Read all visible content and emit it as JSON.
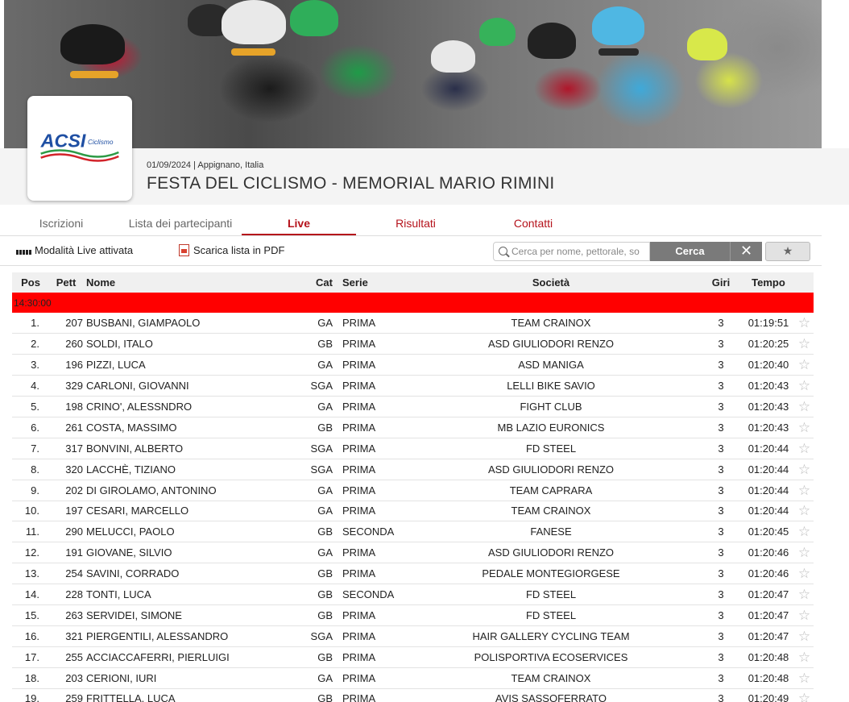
{
  "event": {
    "date_location": "01/09/2024 | Appignano, Italia",
    "title": "FESTA DEL CICLISMO - MEMORIAL MARIO RIMINI",
    "logo_text": "ACSI",
    "logo_subtext": "Ciclismo"
  },
  "tabs": [
    {
      "label": "Iscrizioni"
    },
    {
      "label": "Lista dei partecipanti"
    },
    {
      "label": "Live",
      "active": true
    },
    {
      "label": "Risultati"
    },
    {
      "label": "Contatti"
    }
  ],
  "toolbar": {
    "live_mode": "Modalità Live attivata",
    "pdf_link": "Scarica lista in PDF",
    "search_placeholder": "Cerca per nome, pettorale, so",
    "search_button": "Cerca",
    "clear_button": "✕",
    "favorites_button": "★"
  },
  "table": {
    "headers": {
      "pos": "Pos",
      "pett": "Pett",
      "nome": "Nome",
      "cat": "Cat",
      "serie": "Serie",
      "societa": "Società",
      "giri": "Giri",
      "tempo": "Tempo"
    },
    "group_label": "14:30:00",
    "rows": [
      {
        "pos": "1.",
        "pett": "207",
        "nome": "BUSBANI, GIAMPAOLO",
        "cat": "GA",
        "serie": "PRIMA",
        "societa": "TEAM CRAINOX",
        "giri": "3",
        "tempo": "01:19:51"
      },
      {
        "pos": "2.",
        "pett": "260",
        "nome": "SOLDI, ITALO",
        "cat": "GB",
        "serie": "PRIMA",
        "societa": "ASD GIULIODORI RENZO",
        "giri": "3",
        "tempo": "01:20:25"
      },
      {
        "pos": "3.",
        "pett": "196",
        "nome": "PIZZI, LUCA",
        "cat": "GA",
        "serie": "PRIMA",
        "societa": "ASD MANIGA",
        "giri": "3",
        "tempo": "01:20:40"
      },
      {
        "pos": "4.",
        "pett": "329",
        "nome": "CARLONI, GIOVANNI",
        "cat": "SGA",
        "serie": "PRIMA",
        "societa": "LELLI BIKE SAVIO",
        "giri": "3",
        "tempo": "01:20:43"
      },
      {
        "pos": "5.",
        "pett": "198",
        "nome": "CRINO', ALESSNDRO",
        "cat": "GA",
        "serie": "PRIMA",
        "societa": "FIGHT CLUB",
        "giri": "3",
        "tempo": "01:20:43"
      },
      {
        "pos": "6.",
        "pett": "261",
        "nome": "COSTA, MASSIMO",
        "cat": "GB",
        "serie": "PRIMA",
        "societa": "MB LAZIO EURONICS",
        "giri": "3",
        "tempo": "01:20:43"
      },
      {
        "pos": "7.",
        "pett": "317",
        "nome": "BONVINI, ALBERTO",
        "cat": "SGA",
        "serie": "PRIMA",
        "societa": "FD STEEL",
        "giri": "3",
        "tempo": "01:20:44"
      },
      {
        "pos": "8.",
        "pett": "320",
        "nome": "LACCHÈ, TIZIANO",
        "cat": "SGA",
        "serie": "PRIMA",
        "societa": "ASD GIULIODORI RENZO",
        "giri": "3",
        "tempo": "01:20:44"
      },
      {
        "pos": "9.",
        "pett": "202",
        "nome": "DI GIROLAMO, ANTONINO",
        "cat": "GA",
        "serie": "PRIMA",
        "societa": "TEAM CAPRARA",
        "giri": "3",
        "tempo": "01:20:44"
      },
      {
        "pos": "10.",
        "pett": "197",
        "nome": "CESARI, MARCELLO",
        "cat": "GA",
        "serie": "PRIMA",
        "societa": "TEAM CRAINOX",
        "giri": "3",
        "tempo": "01:20:44"
      },
      {
        "pos": "11.",
        "pett": "290",
        "nome": "MELUCCI, PAOLO",
        "cat": "GB",
        "serie": "SECONDA",
        "societa": "FANESE",
        "giri": "3",
        "tempo": "01:20:45"
      },
      {
        "pos": "12.",
        "pett": "191",
        "nome": "GIOVANE, SILVIO",
        "cat": "GA",
        "serie": "PRIMA",
        "societa": "ASD GIULIODORI RENZO",
        "giri": "3",
        "tempo": "01:20:46"
      },
      {
        "pos": "13.",
        "pett": "254",
        "nome": "SAVINI, CORRADO",
        "cat": "GB",
        "serie": "PRIMA",
        "societa": "PEDALE MONTEGIORGESE",
        "giri": "3",
        "tempo": "01:20:46"
      },
      {
        "pos": "14.",
        "pett": "228",
        "nome": "TONTI, LUCA",
        "cat": "GB",
        "serie": "SECONDA",
        "societa": "FD STEEL",
        "giri": "3",
        "tempo": "01:20:47"
      },
      {
        "pos": "15.",
        "pett": "263",
        "nome": "SERVIDEI, SIMONE",
        "cat": "GB",
        "serie": "PRIMA",
        "societa": "FD STEEL",
        "giri": "3",
        "tempo": "01:20:47"
      },
      {
        "pos": "16.",
        "pett": "321",
        "nome": "PIERGENTILI, ALESSANDRO",
        "cat": "SGA",
        "serie": "PRIMA",
        "societa": "HAIR GALLERY CYCLING TEAM",
        "giri": "3",
        "tempo": "01:20:47"
      },
      {
        "pos": "17.",
        "pett": "255",
        "nome": "ACCIACCAFERRI, PIERLUIGI",
        "cat": "GB",
        "serie": "PRIMA",
        "societa": "POLISPORTIVA ECOSERVICES",
        "giri": "3",
        "tempo": "01:20:48"
      },
      {
        "pos": "18.",
        "pett": "203",
        "nome": "CERIONI, IURI",
        "cat": "GA",
        "serie": "PRIMA",
        "societa": "TEAM CRAINOX",
        "giri": "3",
        "tempo": "01:20:48"
      },
      {
        "pos": "19.",
        "pett": "259",
        "nome": "FRITTELLA, LUCA",
        "cat": "GB",
        "serie": "PRIMA",
        "societa": "AVIS SASSOFERRATO",
        "giri": "3",
        "tempo": "01:20:49"
      }
    ]
  },
  "colors": {
    "accent": "#b5121b",
    "group_row": "#ff0000",
    "button_gray": "#7a7a7a"
  }
}
